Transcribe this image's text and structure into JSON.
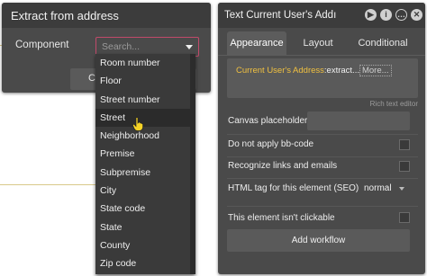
{
  "extract_dialog": {
    "title": "Extract from address",
    "component_label": "Component",
    "select_placeholder": "Search...",
    "button_label": "C"
  },
  "dropdown": {
    "items": [
      "Room number",
      "Floor",
      "Street number",
      "Street",
      "Neighborhood",
      "Premise",
      "Subpremise",
      "City",
      "State code",
      "State",
      "County",
      "Zip code"
    ],
    "hovered": "Street"
  },
  "property_editor": {
    "title": "Text Current User's Addı",
    "header_icons": [
      "play-icon",
      "info-icon",
      "comment-icon",
      "delete-icon"
    ],
    "tabs": [
      "Appearance",
      "Layout",
      "Conditional"
    ],
    "active_tab": "Appearance",
    "expression": {
      "source": "Current User's Address",
      "op": ":extract...",
      "more": "More..."
    },
    "rich_text_link": "Rich text editor",
    "canvas_placeholder_label": "Canvas placeholder",
    "no_bbcode_label": "Do not apply bb-code",
    "recognize_links_label": "Recognize links and emails",
    "html_tag_label": "HTML tag for this element (SEO)",
    "html_tag_value": "normal",
    "not_clickable_label": "This element isn't clickable",
    "add_workflow_label": "Add workflow"
  },
  "colors": {
    "panel_bg": "#4a4a4a",
    "header_bg": "#3c3c3c",
    "expression_highlight": "#f0c040",
    "select_border": "#c04a6a"
  }
}
